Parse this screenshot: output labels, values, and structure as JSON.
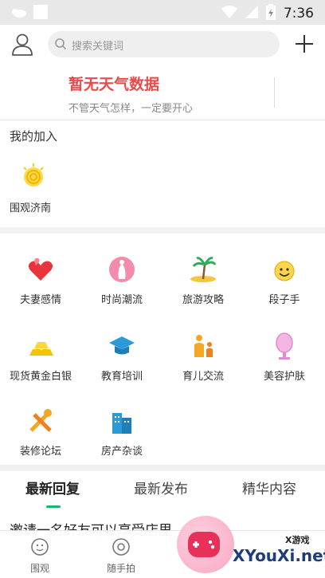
{
  "status": {
    "time": "7:36"
  },
  "header": {
    "search_placeholder": "搜索关键词"
  },
  "weather": {
    "title": "暂无天气数据",
    "subtitle": "不管天气怎样，一定要开心"
  },
  "joined": {
    "title": "我的加入",
    "items": [
      {
        "label": "围观济南"
      }
    ]
  },
  "categories": [
    {
      "label": "夫妻感情",
      "icon": "hearts-icon"
    },
    {
      "label": "时尚潮流",
      "icon": "fashion-icon"
    },
    {
      "label": "旅游攻略",
      "icon": "palm-island-icon"
    },
    {
      "label": "段子手",
      "icon": "smiley-icon"
    },
    {
      "label": "现货黄金白银",
      "icon": "gold-bars-icon"
    },
    {
      "label": "教育培训",
      "icon": "graduation-cap-icon"
    },
    {
      "label": "育儿交流",
      "icon": "parent-child-icon"
    },
    {
      "label": "美容护肤",
      "icon": "mirror-icon"
    },
    {
      "label": "装修论坛",
      "icon": "tools-icon"
    },
    {
      "label": "房产杂谈",
      "icon": "buildings-icon"
    }
  ],
  "tabs": [
    {
      "label": "最新回复"
    },
    {
      "label": "最新发布"
    },
    {
      "label": "精华内容"
    }
  ],
  "feed": {
    "first_title": "邀请一名好友可以享受店里"
  },
  "bottom": [
    {
      "label": "围观",
      "icon": "face-icon"
    },
    {
      "label": "随手拍",
      "icon": "camera-icon"
    }
  ],
  "watermark": {
    "site": "XYouXi.net",
    "brand": "X游戏"
  },
  "colors": {
    "accent": "#20b36b",
    "weather_title": "#e94a4a"
  }
}
